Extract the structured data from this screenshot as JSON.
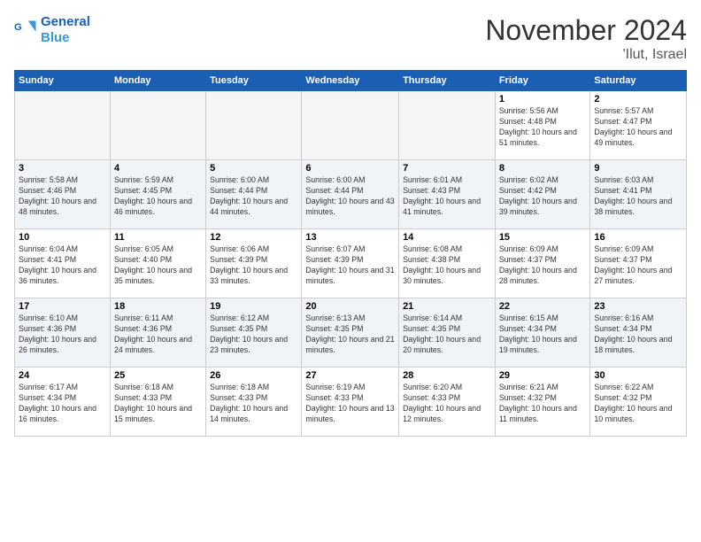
{
  "header": {
    "logo_line1": "General",
    "logo_line2": "Blue",
    "month_title": "November 2024",
    "location": "'Ilut, Israel"
  },
  "weekdays": [
    "Sunday",
    "Monday",
    "Tuesday",
    "Wednesday",
    "Thursday",
    "Friday",
    "Saturday"
  ],
  "weeks": [
    [
      {
        "day": "",
        "empty": true
      },
      {
        "day": "",
        "empty": true
      },
      {
        "day": "",
        "empty": true
      },
      {
        "day": "",
        "empty": true
      },
      {
        "day": "",
        "empty": true
      },
      {
        "day": "1",
        "sunrise": "5:56 AM",
        "sunset": "4:48 PM",
        "daylight": "10 hours and 51 minutes."
      },
      {
        "day": "2",
        "sunrise": "5:57 AM",
        "sunset": "4:47 PM",
        "daylight": "10 hours and 49 minutes."
      }
    ],
    [
      {
        "day": "3",
        "sunrise": "5:58 AM",
        "sunset": "4:46 PM",
        "daylight": "10 hours and 48 minutes."
      },
      {
        "day": "4",
        "sunrise": "5:59 AM",
        "sunset": "4:45 PM",
        "daylight": "10 hours and 46 minutes."
      },
      {
        "day": "5",
        "sunrise": "6:00 AM",
        "sunset": "4:44 PM",
        "daylight": "10 hours and 44 minutes."
      },
      {
        "day": "6",
        "sunrise": "6:00 AM",
        "sunset": "4:44 PM",
        "daylight": "10 hours and 43 minutes."
      },
      {
        "day": "7",
        "sunrise": "6:01 AM",
        "sunset": "4:43 PM",
        "daylight": "10 hours and 41 minutes."
      },
      {
        "day": "8",
        "sunrise": "6:02 AM",
        "sunset": "4:42 PM",
        "daylight": "10 hours and 39 minutes."
      },
      {
        "day": "9",
        "sunrise": "6:03 AM",
        "sunset": "4:41 PM",
        "daylight": "10 hours and 38 minutes."
      }
    ],
    [
      {
        "day": "10",
        "sunrise": "6:04 AM",
        "sunset": "4:41 PM",
        "daylight": "10 hours and 36 minutes."
      },
      {
        "day": "11",
        "sunrise": "6:05 AM",
        "sunset": "4:40 PM",
        "daylight": "10 hours and 35 minutes."
      },
      {
        "day": "12",
        "sunrise": "6:06 AM",
        "sunset": "4:39 PM",
        "daylight": "10 hours and 33 minutes."
      },
      {
        "day": "13",
        "sunrise": "6:07 AM",
        "sunset": "4:39 PM",
        "daylight": "10 hours and 31 minutes."
      },
      {
        "day": "14",
        "sunrise": "6:08 AM",
        "sunset": "4:38 PM",
        "daylight": "10 hours and 30 minutes."
      },
      {
        "day": "15",
        "sunrise": "6:09 AM",
        "sunset": "4:37 PM",
        "daylight": "10 hours and 28 minutes."
      },
      {
        "day": "16",
        "sunrise": "6:09 AM",
        "sunset": "4:37 PM",
        "daylight": "10 hours and 27 minutes."
      }
    ],
    [
      {
        "day": "17",
        "sunrise": "6:10 AM",
        "sunset": "4:36 PM",
        "daylight": "10 hours and 26 minutes."
      },
      {
        "day": "18",
        "sunrise": "6:11 AM",
        "sunset": "4:36 PM",
        "daylight": "10 hours and 24 minutes."
      },
      {
        "day": "19",
        "sunrise": "6:12 AM",
        "sunset": "4:35 PM",
        "daylight": "10 hours and 23 minutes."
      },
      {
        "day": "20",
        "sunrise": "6:13 AM",
        "sunset": "4:35 PM",
        "daylight": "10 hours and 21 minutes."
      },
      {
        "day": "21",
        "sunrise": "6:14 AM",
        "sunset": "4:35 PM",
        "daylight": "10 hours and 20 minutes."
      },
      {
        "day": "22",
        "sunrise": "6:15 AM",
        "sunset": "4:34 PM",
        "daylight": "10 hours and 19 minutes."
      },
      {
        "day": "23",
        "sunrise": "6:16 AM",
        "sunset": "4:34 PM",
        "daylight": "10 hours and 18 minutes."
      }
    ],
    [
      {
        "day": "24",
        "sunrise": "6:17 AM",
        "sunset": "4:34 PM",
        "daylight": "10 hours and 16 minutes."
      },
      {
        "day": "25",
        "sunrise": "6:18 AM",
        "sunset": "4:33 PM",
        "daylight": "10 hours and 15 minutes."
      },
      {
        "day": "26",
        "sunrise": "6:18 AM",
        "sunset": "4:33 PM",
        "daylight": "10 hours and 14 minutes."
      },
      {
        "day": "27",
        "sunrise": "6:19 AM",
        "sunset": "4:33 PM",
        "daylight": "10 hours and 13 minutes."
      },
      {
        "day": "28",
        "sunrise": "6:20 AM",
        "sunset": "4:33 PM",
        "daylight": "10 hours and 12 minutes."
      },
      {
        "day": "29",
        "sunrise": "6:21 AM",
        "sunset": "4:32 PM",
        "daylight": "10 hours and 11 minutes."
      },
      {
        "day": "30",
        "sunrise": "6:22 AM",
        "sunset": "4:32 PM",
        "daylight": "10 hours and 10 minutes."
      }
    ]
  ]
}
